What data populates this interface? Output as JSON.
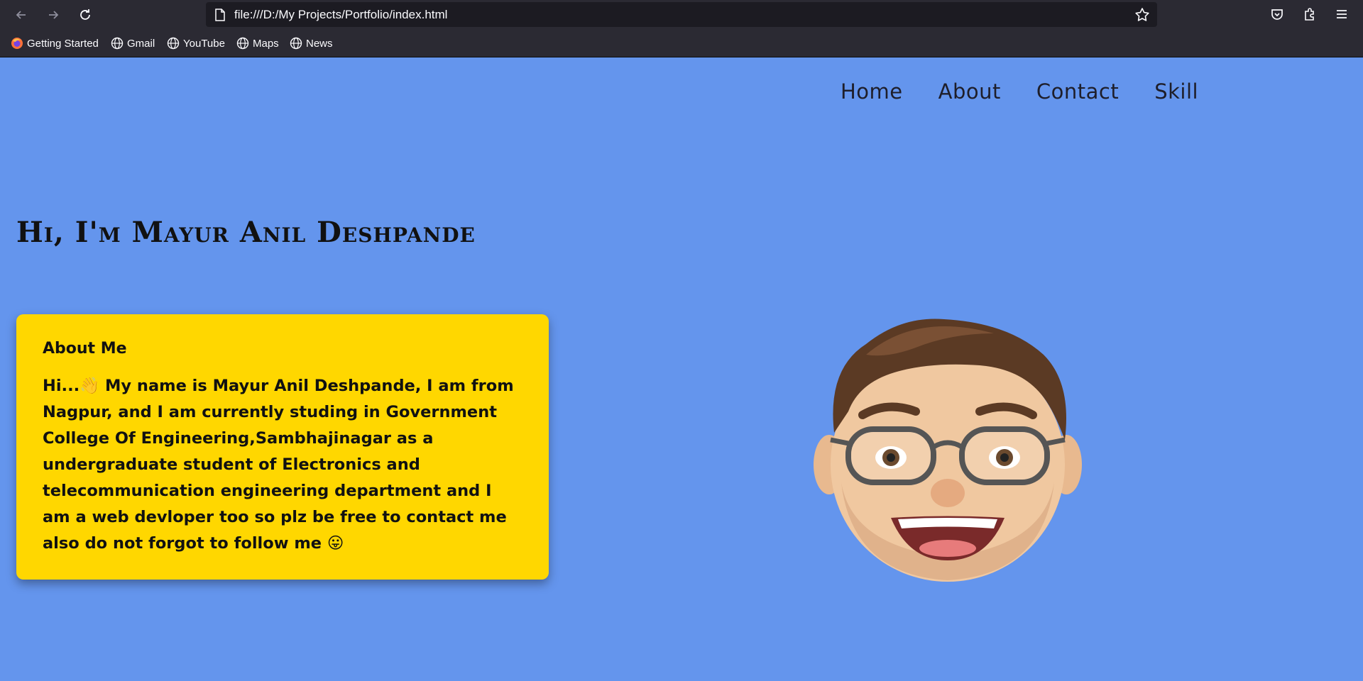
{
  "browser": {
    "url": "file:///D:/My Projects/Portfolio/index.html",
    "bookmarks": [
      {
        "label": "Getting Started",
        "icon": "firefox-icon"
      },
      {
        "label": "Gmail",
        "icon": "globe-icon"
      },
      {
        "label": "YouTube",
        "icon": "globe-icon"
      },
      {
        "label": "Maps",
        "icon": "globe-icon"
      },
      {
        "label": "News",
        "icon": "globe-icon"
      }
    ]
  },
  "site": {
    "nav": [
      "Home",
      "About",
      "Contact",
      "Skill"
    ],
    "title": "Hi, I'm Mayur Anil Deshpande",
    "about": {
      "heading": "About Me",
      "text": "Hi...👋 My name is Mayur Anil Deshpande, I am from Nagpur, and I am currently studing in Government College Of Engineering,Sambhajinagar as a undergraduate student of Electronics and telecommunication engineering department and I am a web devloper too so plz be free to contact me also do not forgot to follow me 😛"
    }
  },
  "colors": {
    "page_background": "#6495ED",
    "card_background": "#FFD700",
    "chrome_background": "#2b2a33"
  }
}
